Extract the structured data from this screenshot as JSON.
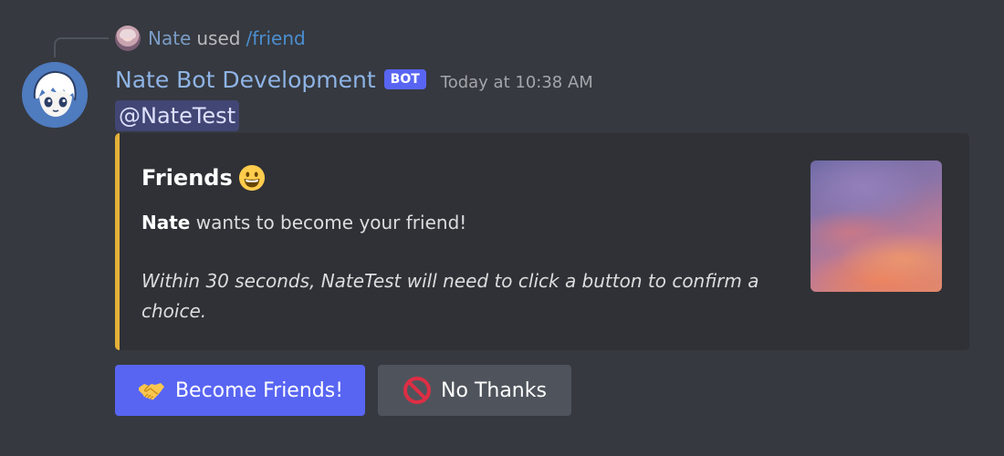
{
  "reply": {
    "name": "Nate",
    "used": "used",
    "command": "/friend"
  },
  "message": {
    "author": "Nate Bot Development",
    "bot_tag": "BOT",
    "timestamp": "Today at 10:38 AM",
    "mention": "@NateTest"
  },
  "embed": {
    "accent_color": "#e4b139",
    "title": "Friends",
    "title_emoji": "grinning-face-icon",
    "desc_name": "Nate",
    "desc_rest": " wants to become your friend!",
    "note": "Within 30 seconds, NateTest will need to click a button to confirm a choice."
  },
  "buttons": {
    "primary": {
      "label": "Become Friends!",
      "icon": "handshake-icon",
      "color": "#5865f2"
    },
    "secondary": {
      "label": "No Thanks",
      "icon": "prohibited-icon",
      "color": "#4f545c"
    }
  }
}
